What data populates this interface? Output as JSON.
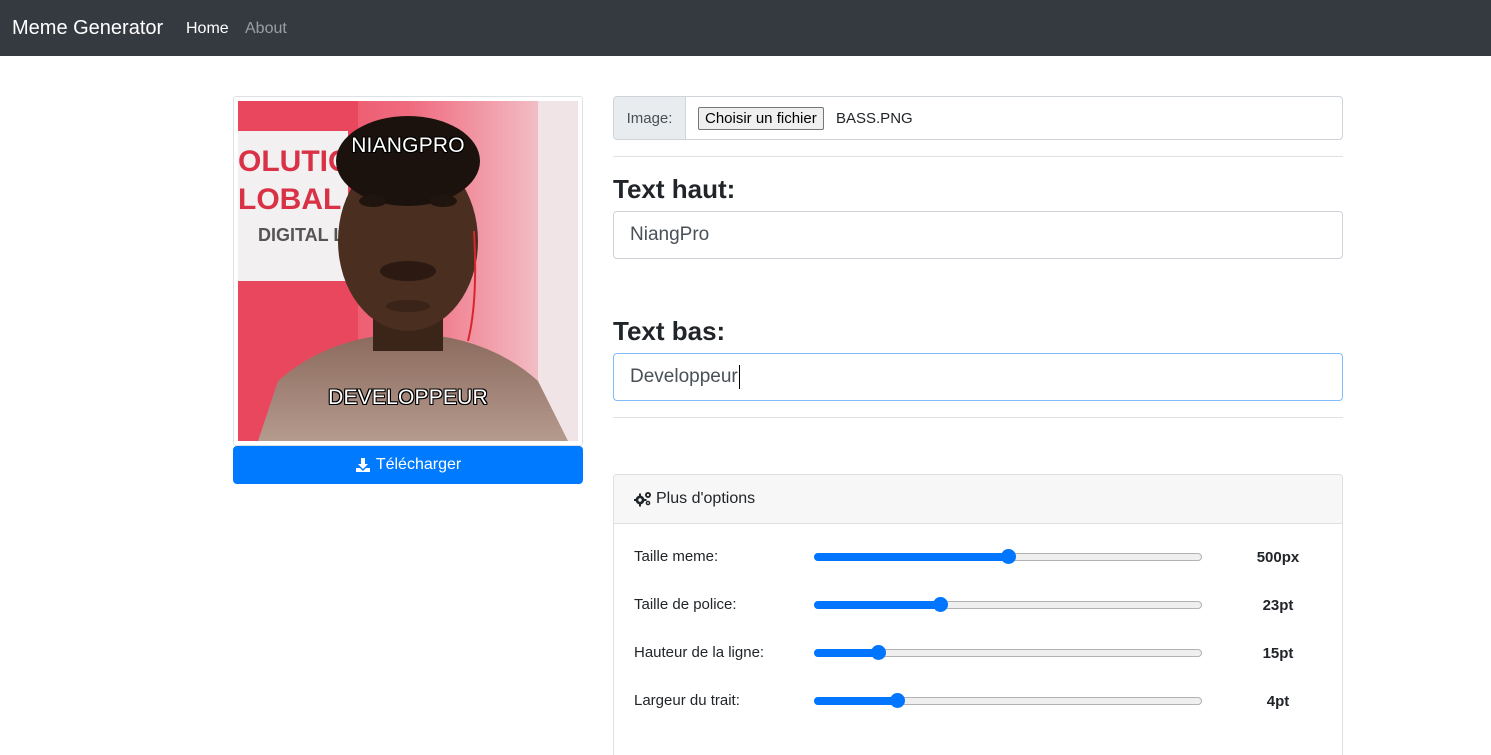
{
  "navbar": {
    "brand": "Meme Generator",
    "links": [
      {
        "label": "Home",
        "active": true
      },
      {
        "label": "About",
        "active": false
      }
    ]
  },
  "meme": {
    "top_text": "NIANGPRO",
    "bottom_text": "DEVELOPPEUR",
    "download_label": "Télécharger",
    "download_icon": "download-icon"
  },
  "form": {
    "image_label": "Image:",
    "file_button": "Choisir un fichier",
    "file_name": "BASS.PNG",
    "top_label": "Text haut:",
    "top_value": "NiangPro",
    "bottom_label": "Text bas:",
    "bottom_value": "Developpeur"
  },
  "options": {
    "header": "Plus d'options",
    "header_icon": "cogs-icon",
    "items": [
      {
        "label": "Taille meme:",
        "value": "500px",
        "level": 0.5
      },
      {
        "label": "Taille de police:",
        "value": "23pt",
        "level": 0.325
      },
      {
        "label": "Hauteur de la ligne:",
        "value": "15pt",
        "level": 0.165
      },
      {
        "label": "Largeur du trait:",
        "value": "4pt",
        "level": 0.213
      }
    ]
  },
  "colors": {
    "navbar_bg": "#343a40",
    "primary": "#007bff",
    "slider_accent": "#0075ff"
  }
}
